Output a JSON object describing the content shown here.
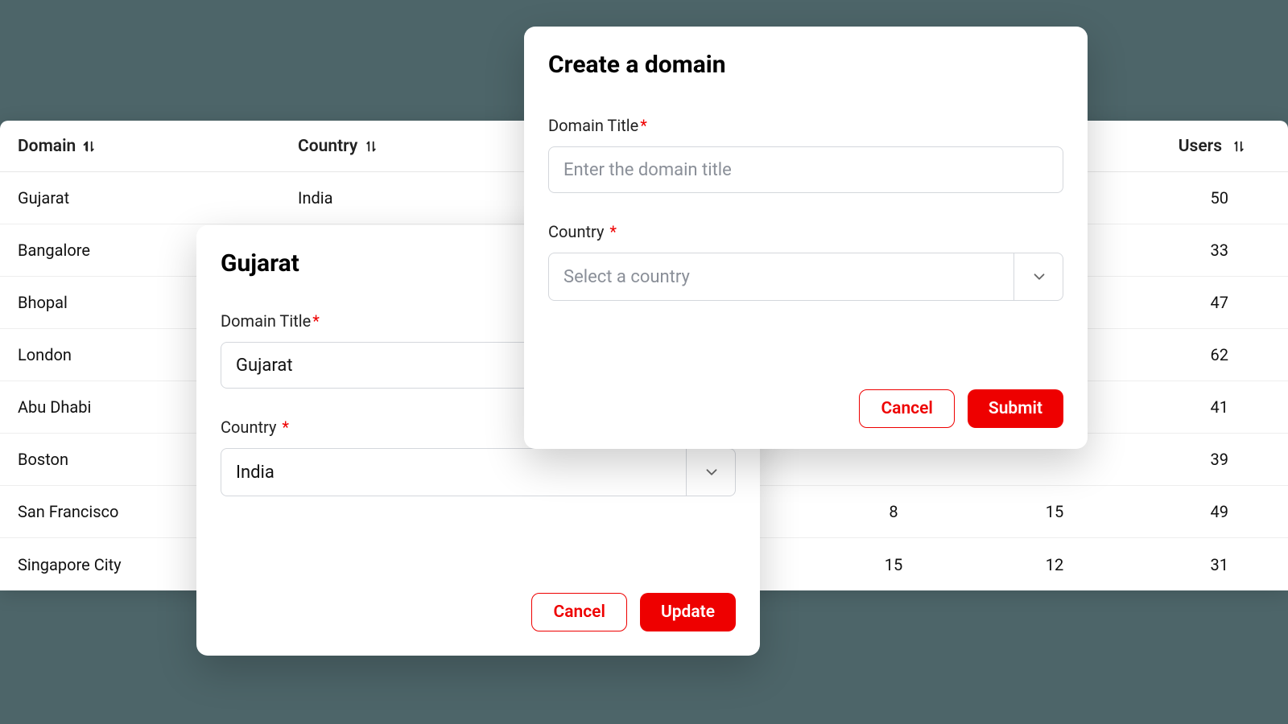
{
  "table": {
    "headers": {
      "domain": "Domain",
      "country": "Country",
      "users": "Users"
    },
    "rows": [
      {
        "domain": "Gujarat",
        "country": "India",
        "a": "",
        "b": "",
        "users": "50"
      },
      {
        "domain": "Bangalore",
        "country": "",
        "a": "",
        "b": "",
        "users": "33"
      },
      {
        "domain": "Bhopal",
        "country": "",
        "a": "",
        "b": "",
        "users": "47"
      },
      {
        "domain": "London",
        "country": "",
        "a": "",
        "b": "",
        "users": "62"
      },
      {
        "domain": "Abu Dhabi",
        "country": "",
        "a": "",
        "b": "",
        "users": "41"
      },
      {
        "domain": "Boston",
        "country": "",
        "a": "",
        "b": "",
        "users": "39"
      },
      {
        "domain": "San Francisco",
        "country": "",
        "a": "8",
        "b": "15",
        "users": "49"
      },
      {
        "domain": "Singapore City",
        "country": "",
        "a": "15",
        "b": "12",
        "users": "31"
      }
    ]
  },
  "editModal": {
    "title": "Gujarat",
    "domainLabel": "Domain Title",
    "domainValue": "Gujarat",
    "countryLabel": "Country",
    "countryValue": "India",
    "cancel": "Cancel",
    "submit": "Update"
  },
  "createModal": {
    "title": "Create a domain",
    "domainLabel": "Domain Title",
    "domainPlaceholder": "Enter the domain title",
    "countryLabel": "Country",
    "countryPlaceholder": "Select a country",
    "cancel": "Cancel",
    "submit": "Submit"
  },
  "colors": {
    "accent": "#ee0000"
  }
}
